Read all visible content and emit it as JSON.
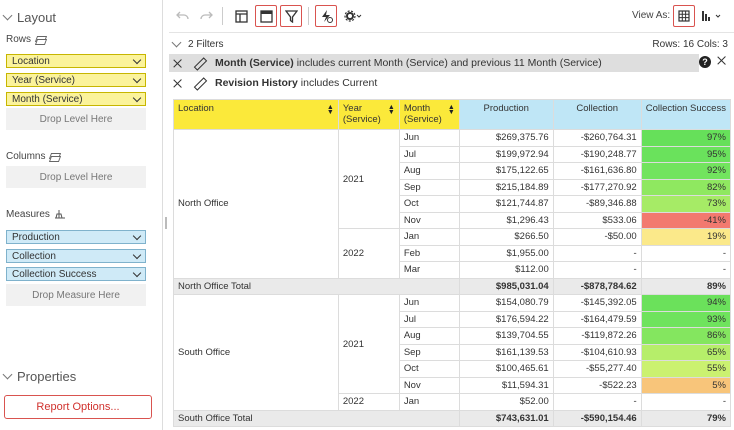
{
  "left": {
    "layout_title": "Layout",
    "rows_label": "Rows",
    "rows": [
      "Location",
      "Year (Service)",
      "Month (Service)"
    ],
    "columns_label": "Columns",
    "measures_label": "Measures",
    "measures": [
      "Production",
      "Collection",
      "Collection Success"
    ],
    "drop_level": "Drop Level Here",
    "drop_measure": "Drop Measure Here",
    "properties_title": "Properties",
    "report_options": "Report Options..."
  },
  "toolbar": {
    "view_as": "View As:"
  },
  "filters": {
    "count_label": "2 Filters",
    "rows_cols": "Rows: 16  Cols: 3",
    "filter1_bold": "Month (Service)",
    "filter1_rest": "includes current Month (Service) and previous 11 Month (Service)",
    "filter2_bold": "Revision History",
    "filter2_rest": "includes Current"
  },
  "grid": {
    "headers": {
      "location": "Location",
      "year": "Year (Service)",
      "month": "Month (Service)",
      "production": "Production",
      "collection": "Collection",
      "success": "Collection Success"
    },
    "north": {
      "location": "North Office",
      "y2021": "2021",
      "y2022": "2022",
      "rows": [
        {
          "month": "Jun",
          "prod": "$269,375.76",
          "coll": "-$260,764.31",
          "succ": "97%"
        },
        {
          "month": "Jul",
          "prod": "$199,972.94",
          "coll": "-$190,248.77",
          "succ": "95%"
        },
        {
          "month": "Aug",
          "prod": "$175,122.65",
          "coll": "-$161,636.80",
          "succ": "92%"
        },
        {
          "month": "Sep",
          "prod": "$215,184.89",
          "coll": "-$177,270.92",
          "succ": "82%"
        },
        {
          "month": "Oct",
          "prod": "$121,744.87",
          "coll": "-$89,346.88",
          "succ": "73%"
        },
        {
          "month": "Nov",
          "prod": "$1,296.43",
          "coll": "$533.06",
          "succ": "-41%"
        },
        {
          "month": "Jan",
          "prod": "$266.50",
          "coll": "-$50.00",
          "succ": "19%"
        },
        {
          "month": "Feb",
          "prod": "$1,955.00",
          "coll": "-",
          "succ": "-"
        },
        {
          "month": "Mar",
          "prod": "$112.00",
          "coll": "-",
          "succ": "-"
        }
      ],
      "total_label": "North Office Total",
      "total": {
        "prod": "$985,031.04",
        "coll": "-$878,784.62",
        "succ": "89%"
      }
    },
    "south": {
      "location": "South Office",
      "y2021": "2021",
      "y2022": "2022",
      "rows": [
        {
          "month": "Jun",
          "prod": "$154,080.79",
          "coll": "-$145,392.05",
          "succ": "94%"
        },
        {
          "month": "Jul",
          "prod": "$176,594.22",
          "coll": "-$164,479.59",
          "succ": "93%"
        },
        {
          "month": "Aug",
          "prod": "$139,704.55",
          "coll": "-$119,872.26",
          "succ": "86%"
        },
        {
          "month": "Sep",
          "prod": "$161,139.53",
          "coll": "-$104,610.93",
          "succ": "65%"
        },
        {
          "month": "Oct",
          "prod": "$100,465.61",
          "coll": "-$55,277.40",
          "succ": "55%"
        },
        {
          "month": "Nov",
          "prod": "$11,594.31",
          "coll": "-$522.23",
          "succ": "5%"
        },
        {
          "month": "Jan",
          "prod": "$52.00",
          "coll": "-",
          "succ": "-"
        }
      ],
      "total_label": "South Office Total",
      "total": {
        "prod": "$743,631.01",
        "coll": "-$590,154.46",
        "succ": "79%"
      }
    }
  },
  "colors": {
    "success_97": "#66e05a",
    "success_95": "#6ae25c",
    "success_92": "#72e45e",
    "success_82": "#8fe860",
    "success_73": "#a6eb66",
    "success_neg41": "#f2796f",
    "success_19": "#fbe98a",
    "success_94": "#6be15b",
    "success_93": "#6fe35d",
    "success_86": "#84e65f",
    "success_65": "#b6ee6a",
    "success_55": "#cbf170",
    "success_5": "#f8c57a"
  }
}
